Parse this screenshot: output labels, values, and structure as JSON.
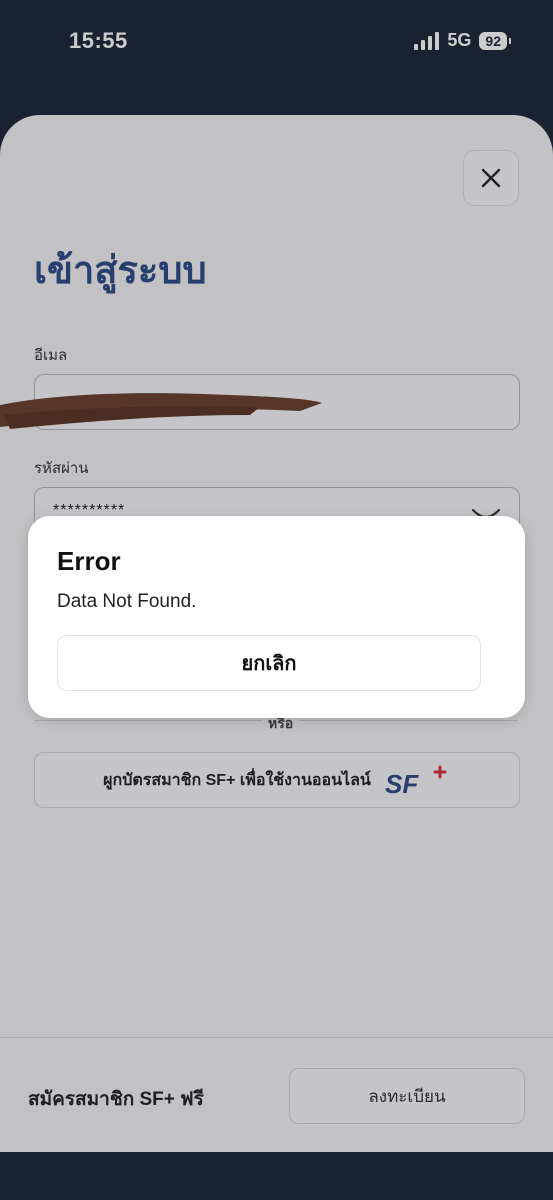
{
  "status_bar": {
    "time": "15:55",
    "network": "5G",
    "battery": "92"
  },
  "login": {
    "title": "เข้าสู่ระบบ",
    "email_label": "อีเมล",
    "password_label": "รหัสผ่าน",
    "password_value": "**********",
    "or_text": "หรือ",
    "sf_bind_label": "ผูกบัตรสมาชิก SF+ เพื่อใช้งานออนไลน์",
    "sf_logo": "SF"
  },
  "footer": {
    "signup_text": "สมัครสมาชิก SF+ ฟรี",
    "register_label": "ลงทะเบียน"
  },
  "modal": {
    "title": "Error",
    "message": "Data Not Found.",
    "cancel_label": "ยกเลิก"
  },
  "colors": {
    "brand_blue": "#2c4a86",
    "sf_red": "#d9313c",
    "dark_bg": "#1b2436"
  }
}
